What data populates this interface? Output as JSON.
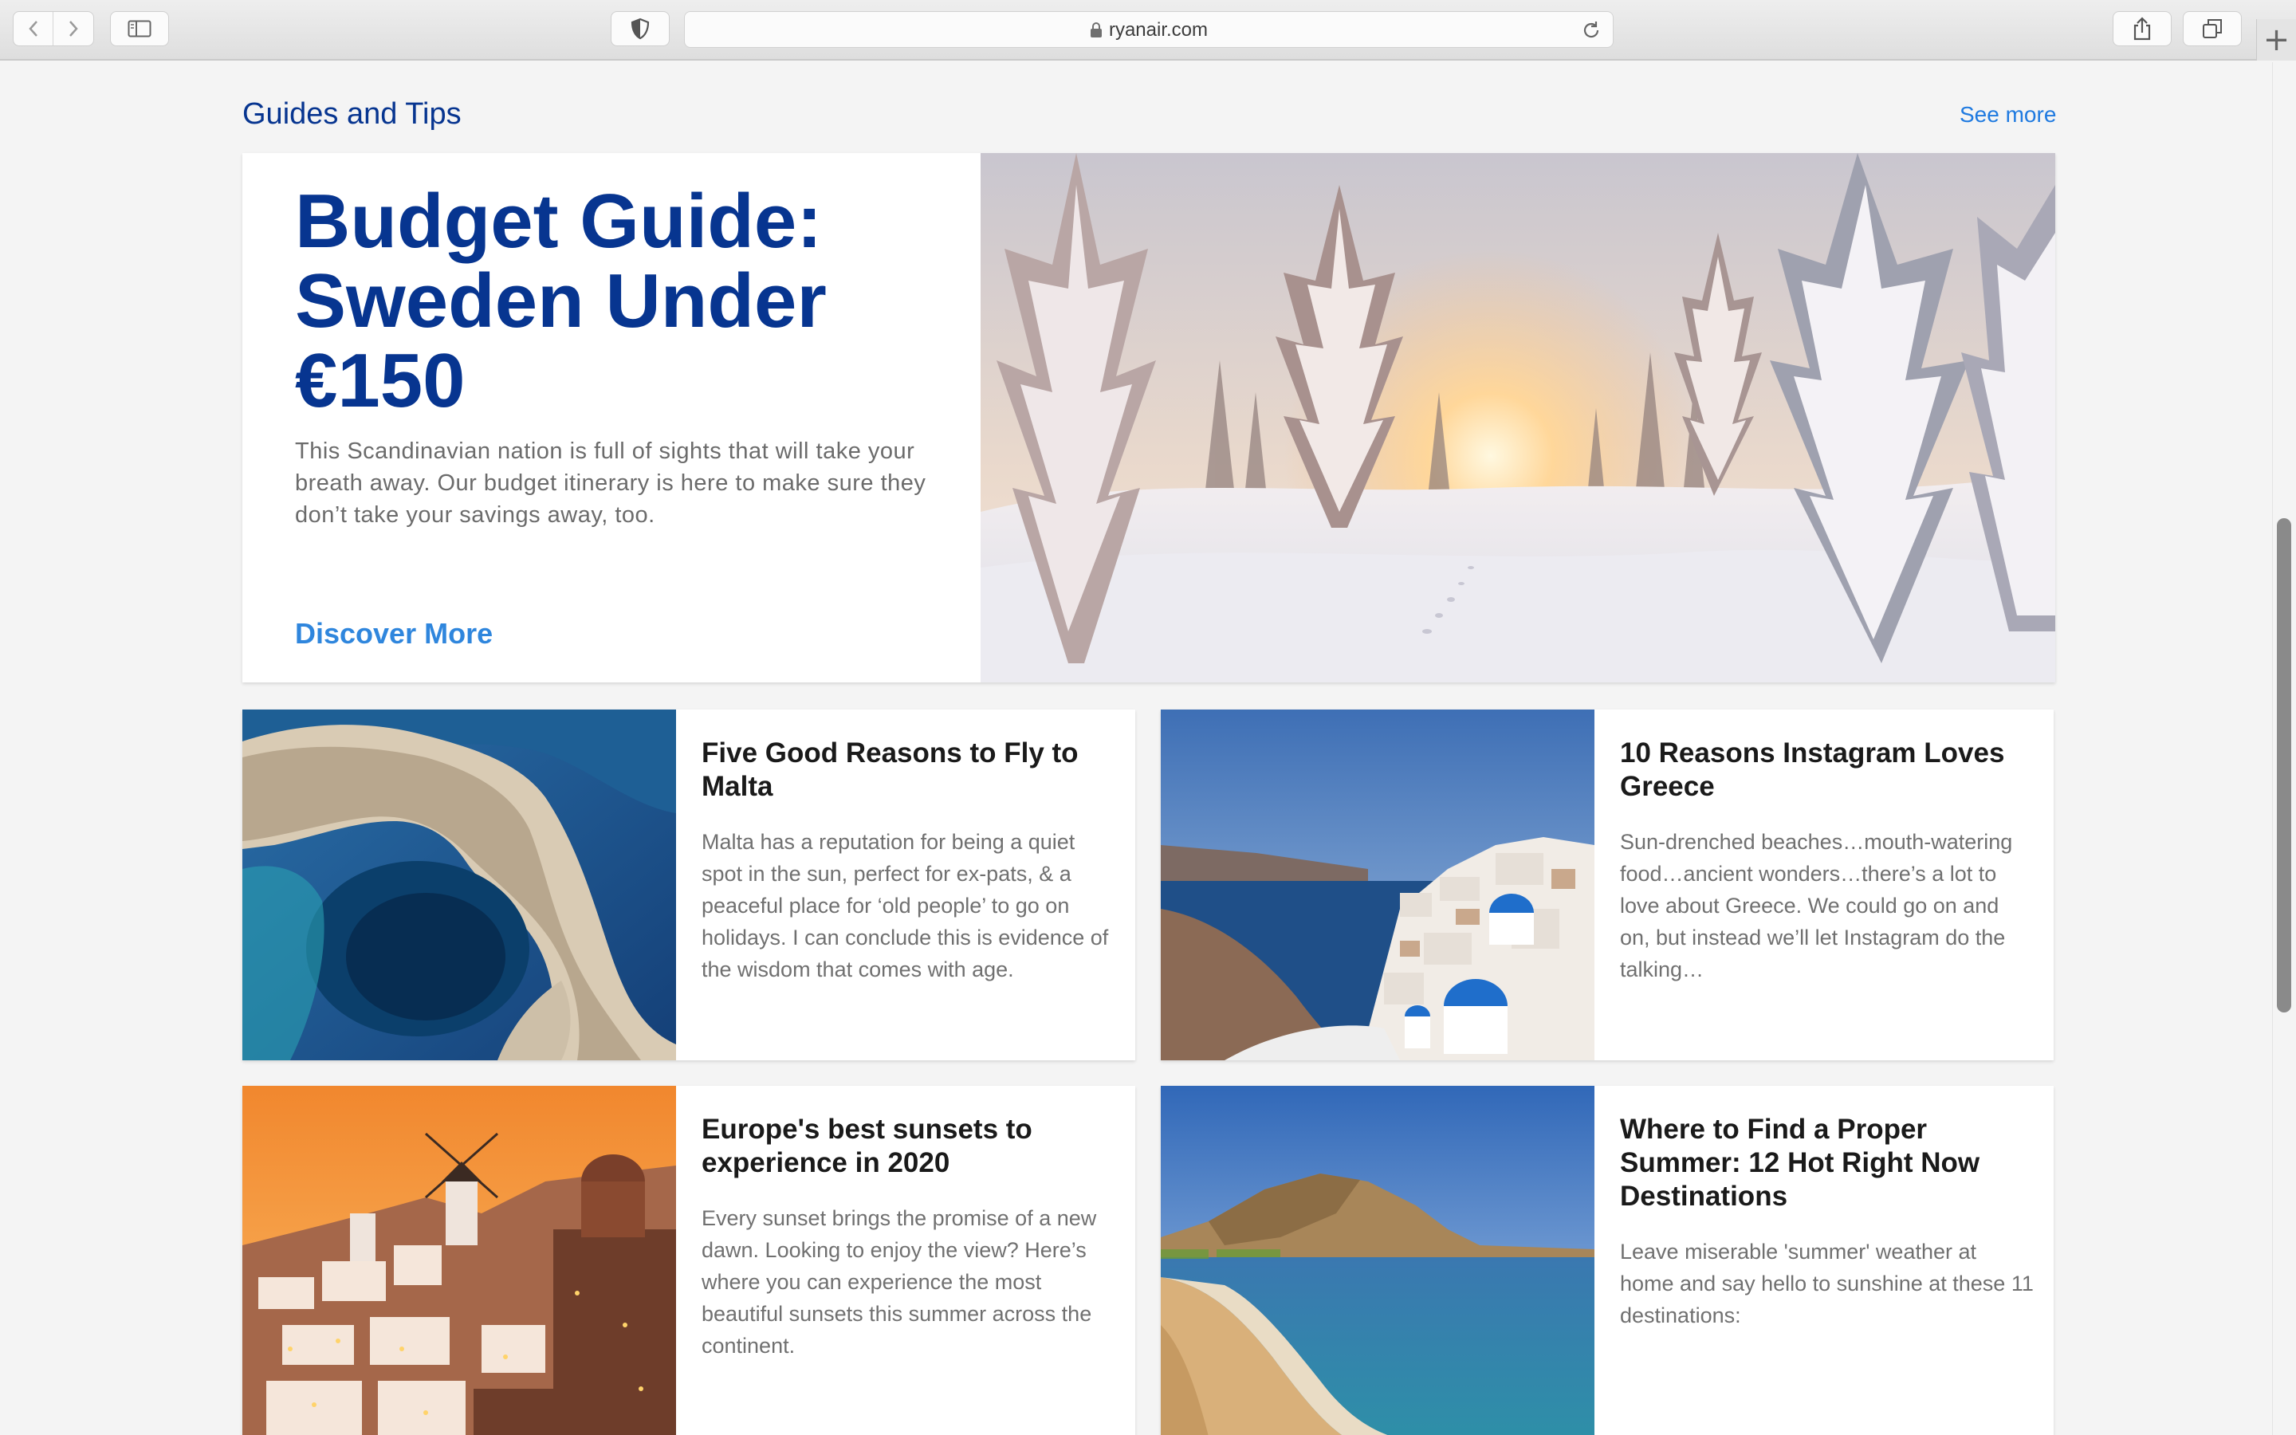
{
  "browser": {
    "url": "ryanair.com"
  },
  "section": {
    "title": "Guides and Tips",
    "see_more": "See more"
  },
  "featured": {
    "title": "Budget Guide: Sweden Under €150",
    "description": "This Scandinavian nation is full of sights that will take your breath away. Our budget itinerary is here to make sure they don’t take your savings away, too.",
    "cta": "Discover More"
  },
  "cards": [
    {
      "title": "Five Good Reasons to Fly to Malta",
      "description": "Malta has a reputation for being a quiet spot in the sun, perfect for ex-pats, & a peaceful place for ‘old people’ to go on holidays. I can conclude this is evidence of the wisdom that comes with age."
    },
    {
      "title": "10 Reasons Instagram Loves Greece",
      "description": "Sun-drenched beaches…mouth-watering food…ancient wonders…there’s a lot to love about Greece. We could go on and on, but instead we’ll let Instagram do the talking…"
    },
    {
      "title": "Europe's best sunsets to experience in 2020",
      "description": "Every sunset brings the promise of a new dawn. Looking to enjoy the view? Here’s where you can experience the most beautiful sunsets this summer across the continent."
    },
    {
      "title": "Where to Find a Proper Summer: 12 Hot Right Now Destinations",
      "description": "Leave miserable 'summer' weather at home and say hello to sunshine at these 11 destinations:"
    }
  ],
  "colors": {
    "brand_navy": "#073590",
    "link_blue": "#2f86dd",
    "background": "#f4f4f4"
  }
}
